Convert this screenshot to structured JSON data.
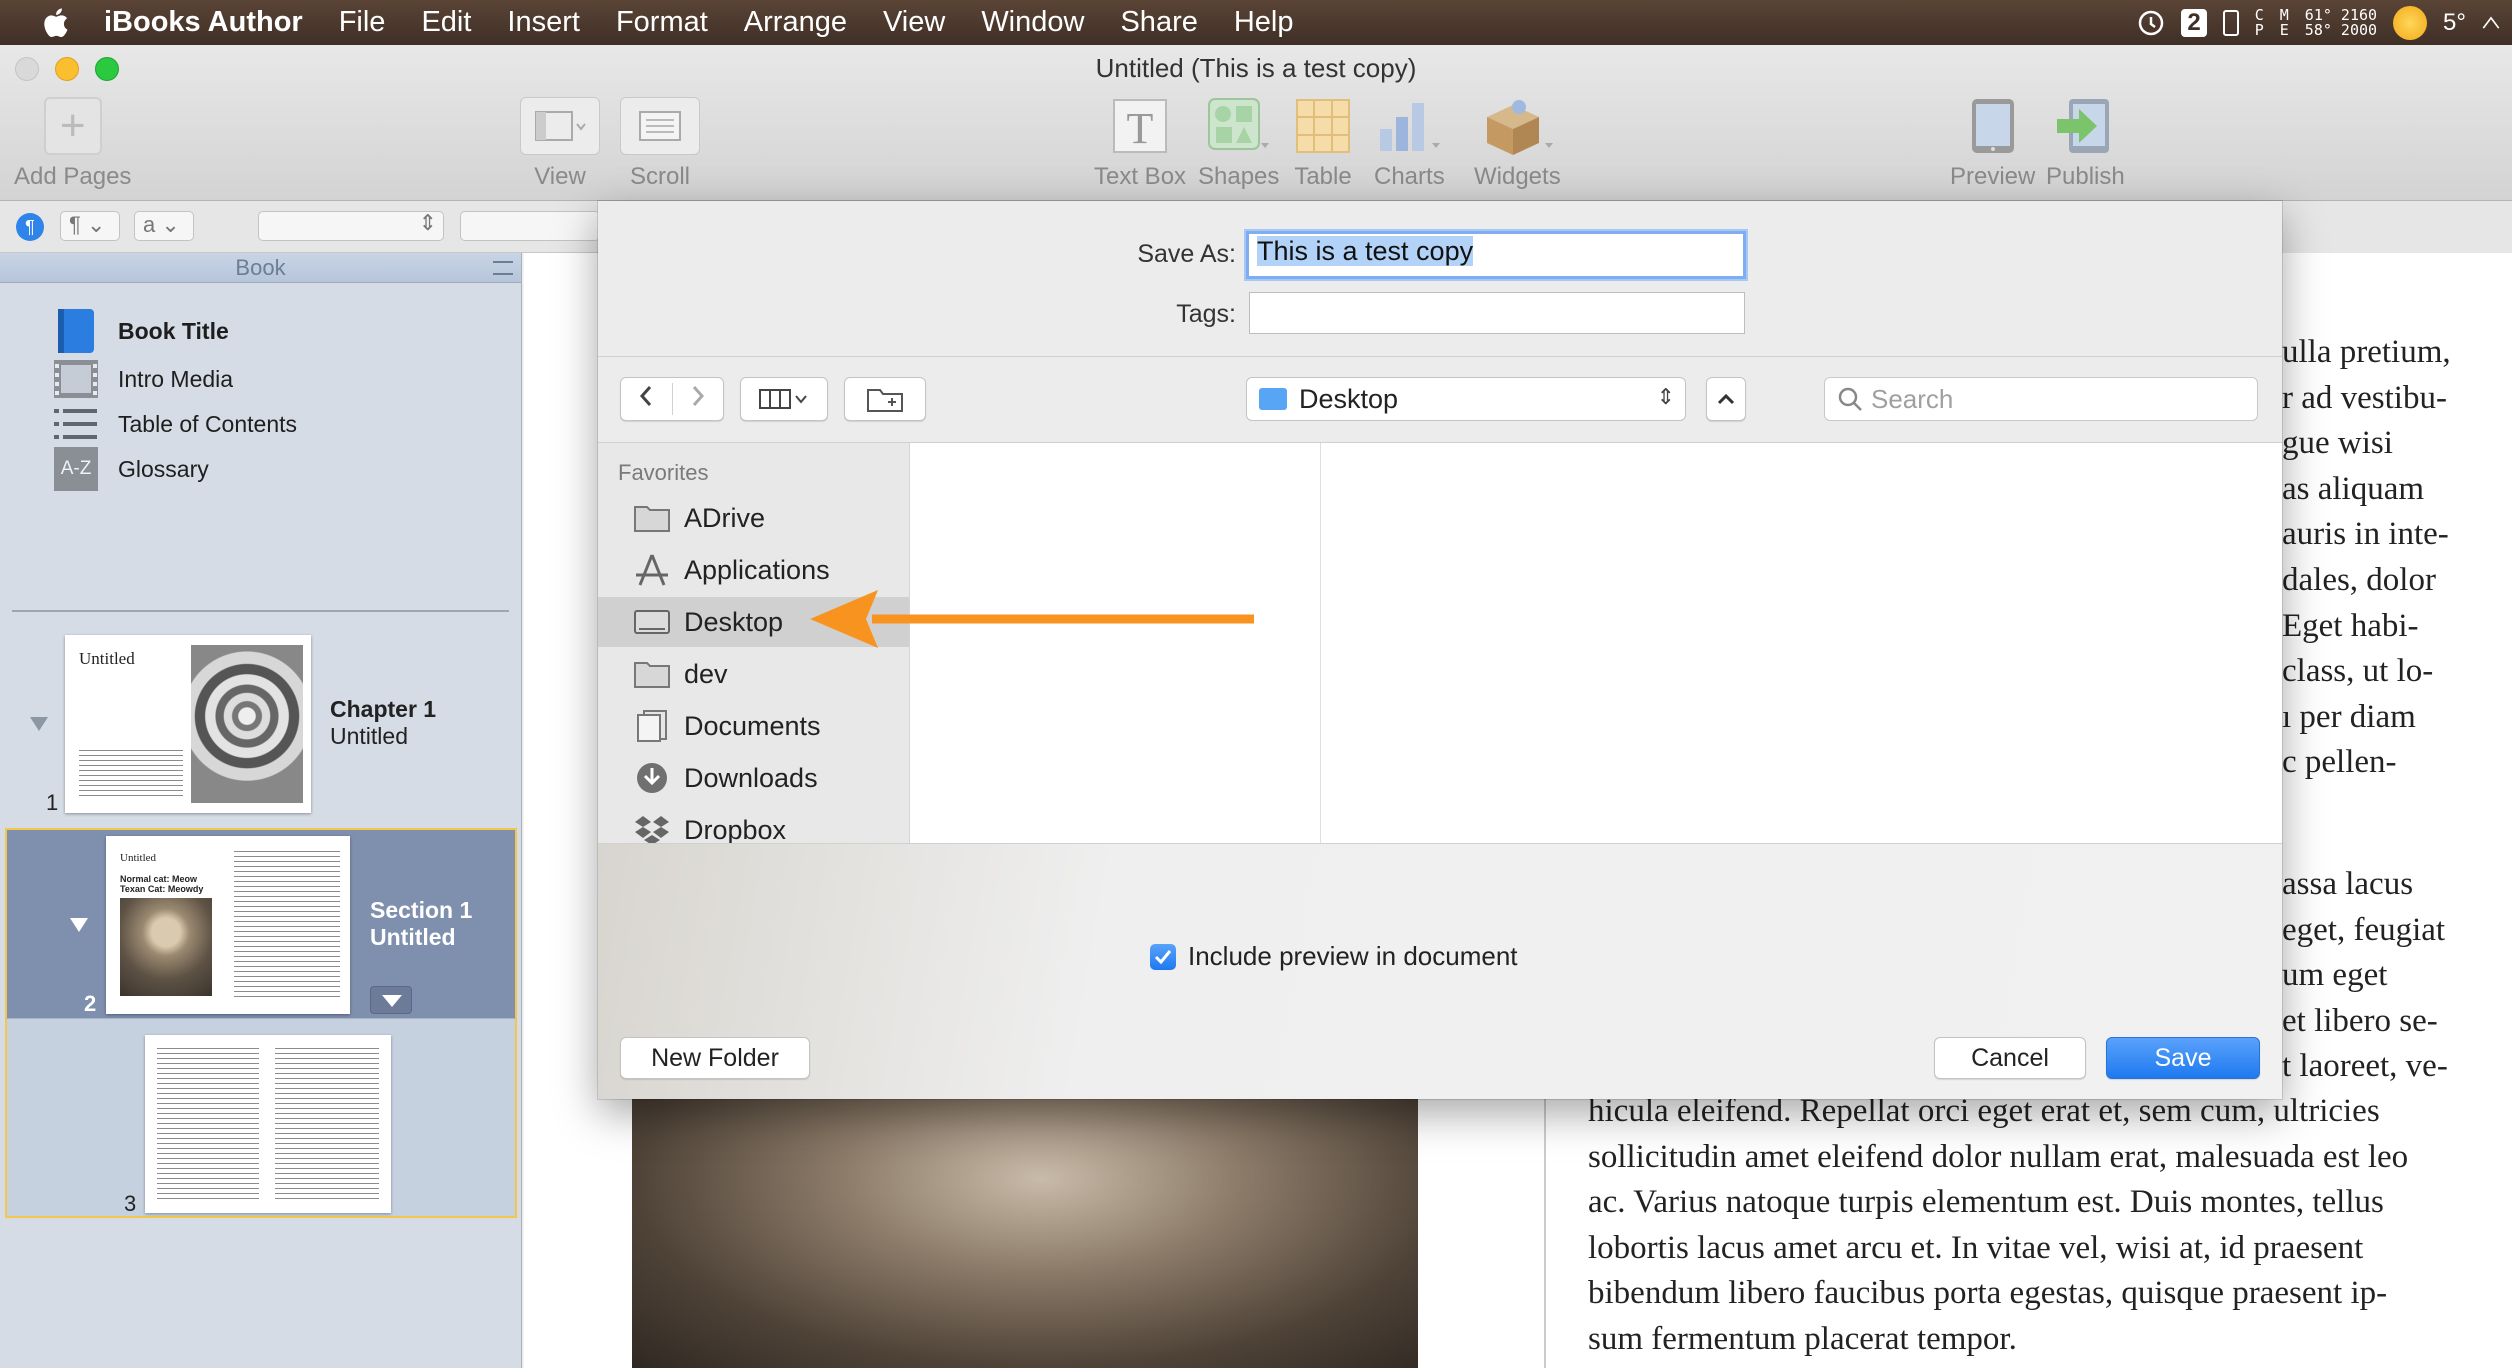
{
  "menubar": {
    "app_name": "iBooks Author",
    "items": [
      "File",
      "Edit",
      "Insert",
      "Format",
      "Arrange",
      "View",
      "Window",
      "Share",
      "Help"
    ],
    "status": {
      "badge": "2",
      "temps_top": "61° 2160",
      "temps_bottom": "58° 2000",
      "weather": "5°"
    }
  },
  "window": {
    "title": "Untitled (This is a test copy)"
  },
  "toolbar": {
    "add_pages": "Add Pages",
    "view": "View",
    "scroll": "Scroll",
    "text_box": "Text Box",
    "shapes": "Shapes",
    "table": "Table",
    "charts": "Charts",
    "widgets": "Widgets",
    "preview": "Preview",
    "publish": "Publish"
  },
  "formatbar": {
    "paragraph_style": "¶",
    "char_style": "a"
  },
  "sidebar": {
    "header": "Book",
    "items": [
      {
        "label": "Book Title",
        "icon": "book-icon"
      },
      {
        "label": "Intro Media",
        "icon": "film-icon"
      },
      {
        "label": "Table of Contents",
        "icon": "list-icon"
      },
      {
        "label": "Glossary",
        "icon": "glossary-icon"
      }
    ],
    "glossary_icon_text": "A-Z",
    "chapter": {
      "number": "1",
      "title": "Chapter 1",
      "subtitle": "Untitled",
      "thumb_heading": "Untitled"
    },
    "section": {
      "number": "2",
      "title": "Section 1",
      "subtitle": "Untitled",
      "thumb_heading": "Untitled",
      "thumb_caption": "Normal cat: Meow\nTexan Cat: Meowdy"
    },
    "page3": {
      "number": "3"
    }
  },
  "document": {
    "right_fragments": [
      "ulla pretium,",
      "r ad vestibu-",
      "gue wisi",
      "as aliquam",
      "auris in inte-",
      "dales, dolor",
      "Eget habi-",
      "class, ut lo-",
      "ı per diam",
      "c pellen-"
    ],
    "right_fragments_2": [
      "assa lacus",
      "eget, feugiat",
      "um eget",
      "et libero se-",
      "t laoreet, ve-"
    ],
    "paragraph_lines": [
      "hicula eleifend. Repellat orci eget erat et, sem cum, ultricies",
      "sollicitudin amet eleifend dolor nullam erat, malesuada est leo",
      "ac. Varius natoque turpis elementum est. Duis montes, tellus",
      "lobortis lacus amet arcu et. In vitae vel, wisi at, id praesent",
      "bibendum libero faucibus porta egestas, quisque praesent ip-",
      "sum fermentum placerat tempor."
    ]
  },
  "save_sheet": {
    "save_as_label": "Save As:",
    "save_as_value": "This is a test copy",
    "tags_label": "Tags:",
    "tags_value": "",
    "location": "Desktop",
    "search_placeholder": "Search",
    "favorites_header": "Favorites",
    "favorites": [
      {
        "label": "ADrive",
        "icon": "folder-icon"
      },
      {
        "label": "Applications",
        "icon": "applications-icon"
      },
      {
        "label": "Desktop",
        "icon": "desktop-icon",
        "selected": true
      },
      {
        "label": "dev",
        "icon": "folder-icon"
      },
      {
        "label": "Documents",
        "icon": "documents-icon"
      },
      {
        "label": "Downloads",
        "icon": "downloads-icon"
      },
      {
        "label": "Dropbox",
        "icon": "dropbox-icon"
      }
    ],
    "include_preview_label": "Include preview in document",
    "include_preview_checked": true,
    "new_folder": "New Folder",
    "cancel": "Cancel",
    "save": "Save"
  },
  "colors": {
    "accent_blue": "#1e79f0",
    "annotation_arrow": "#f7931e",
    "section_highlight": "#f3c84a"
  }
}
